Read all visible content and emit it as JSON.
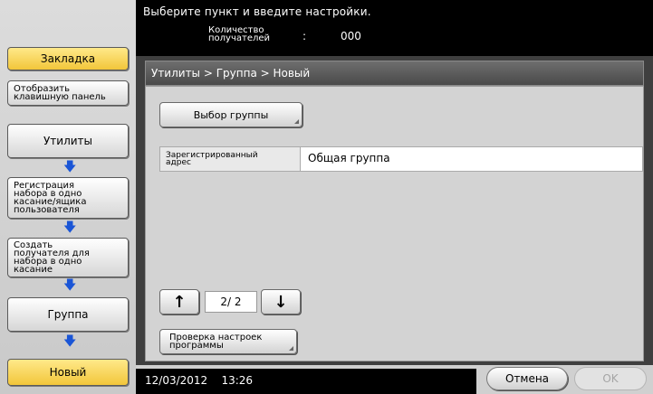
{
  "header": {
    "instruction": "Выберите пункт и введите настройки.",
    "recipients_label_line1": "Количество",
    "recipients_label_line2": "получателей",
    "recipients_separator": ":",
    "recipients_count": "000"
  },
  "sidebar": {
    "bookmark": "Закладка",
    "keyboard_line1": "Отобразить",
    "keyboard_line2": "клавишную панель",
    "utilities": "Утилиты",
    "registration_line1": "Регистрация",
    "registration_line2": "набора в одно",
    "registration_line3": "касание/ящика",
    "registration_line4": "пользователя",
    "create_line1": "Создать",
    "create_line2": "получателя для",
    "create_line3": "набора в одно",
    "create_line4": "касание",
    "group": "Группа",
    "new": "Новый"
  },
  "breadcrumb": {
    "path": "Утилиты > Группа > Новый"
  },
  "content": {
    "select_group_button": "Выбор группы",
    "addr_label_line1": "Зарегистрированный",
    "addr_label_line2": "адрес",
    "addr_value": "Общая группа",
    "page_indicator": "2/ 2",
    "check_program_line1": "Проверка настроек",
    "check_program_line2": "программы"
  },
  "footer": {
    "date": "12/03/2012",
    "time": "13:26",
    "cancel_label": "Отмена",
    "ok_label": "OK"
  },
  "icons": {
    "page_up": "up-arrow-icon",
    "page_down": "down-arrow-icon",
    "step_arrow": "blue-down-arrow-icon"
  },
  "colors": {
    "accent_gold": "#f2c63a",
    "step_arrow_blue": "#1a55d6",
    "header_bg": "#000000"
  }
}
